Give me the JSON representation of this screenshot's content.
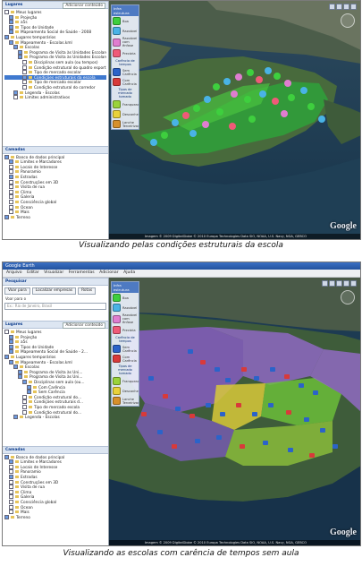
{
  "shot1": {
    "caption": "Visualizando pelas condições estruturais da escola",
    "left": {
      "lugares_header": "Lugares",
      "adicionar_conteudo": "Adicionar conteúdo",
      "lugares_items": [
        {
          "label": "Meus lugares",
          "indent": 0,
          "check": false,
          "selected": false
        },
        {
          "label": "Projeção",
          "indent": 1,
          "check": true,
          "selected": false
        },
        {
          "label": "a5s",
          "indent": 1,
          "check": true,
          "selected": false
        },
        {
          "label": "Tipos de Unidade",
          "indent": 1,
          "check": true,
          "selected": false
        },
        {
          "label": "Mapeamento Social de Saúde - 2008",
          "indent": 1,
          "check": true,
          "selected": false
        },
        {
          "label": "Lugares temporários",
          "indent": 0,
          "check": true,
          "selected": false
        },
        {
          "label": "Mapeamento - Escolas.kml",
          "indent": 1,
          "check": true,
          "selected": false
        },
        {
          "label": "Escolas",
          "indent": 2,
          "check": true,
          "selected": false
        },
        {
          "label": "Programa de Visita às Unidades Escolares / 2008",
          "indent": 3,
          "check": true,
          "selected": false
        },
        {
          "label": "Programa de Visita às Unidades Escolares / 2008",
          "indent": 3,
          "check": true,
          "selected": false
        },
        {
          "label": "Disciplinas sem aula (ou tempos)",
          "indent": 4,
          "check": false,
          "selected": false
        },
        {
          "label": "Condição estrutural do quadro esportivo",
          "indent": 4,
          "check": false,
          "selected": false
        },
        {
          "label": "Tipo de mercado escolar",
          "indent": 4,
          "check": false,
          "selected": false
        },
        {
          "label": "Condições estruturais da escola",
          "indent": 4,
          "check": true,
          "selected": true
        },
        {
          "label": "Tipo de mercado escolar",
          "indent": 4,
          "check": false,
          "selected": false
        },
        {
          "label": "Condição estrutural do corredor",
          "indent": 4,
          "check": false,
          "selected": false
        },
        {
          "label": "Legenda - Escolas",
          "indent": 2,
          "check": true,
          "selected": false
        },
        {
          "label": "Limites administrativos",
          "indent": 2,
          "check": false,
          "selected": false
        }
      ],
      "camadas_header": "Camadas",
      "camadas_items": [
        {
          "label": "Banco de dados principal",
          "indent": 0,
          "check": true
        },
        {
          "label": "Limites e Marcadores",
          "indent": 1,
          "check": true
        },
        {
          "label": "Locais de Interesse",
          "indent": 1,
          "check": false
        },
        {
          "label": "Panoramio",
          "indent": 1,
          "check": false
        },
        {
          "label": "Estradas",
          "indent": 1,
          "check": true
        },
        {
          "label": "Construções em 3D",
          "indent": 1,
          "check": false
        },
        {
          "label": "Visita de rua",
          "indent": 1,
          "check": false
        },
        {
          "label": "Clima",
          "indent": 1,
          "check": false
        },
        {
          "label": "Galeria",
          "indent": 1,
          "check": false
        },
        {
          "label": "Consciência global",
          "indent": 1,
          "check": false
        },
        {
          "label": "Ocean",
          "indent": 1,
          "check": false
        },
        {
          "label": "Mais",
          "indent": 1,
          "check": false
        },
        {
          "label": "Terreno",
          "indent": 0,
          "check": true
        }
      ]
    },
    "legend": {
      "header": "Infra estrutura",
      "items_a": [
        {
          "label": "Boa",
          "color": "#3ecf3e"
        },
        {
          "label": "Razoável",
          "color": "#49b3e6"
        },
        {
          "label": "Razoável com ênfase",
          "color": "#e07dd0"
        },
        {
          "label": "Precária",
          "color": "#f05a78"
        }
      ],
      "section_b": "Carência de tempos",
      "items_b": [
        {
          "label": "Sem Carência",
          "color": "#2b63c9"
        },
        {
          "label": "Com Carência",
          "color": "#d83a3a"
        }
      ],
      "section_c": "Tipos de mercado tomado",
      "items_c": [
        {
          "label": "Franqueado",
          "color": "#9ad33b"
        },
        {
          "label": "Desconhecido",
          "color": "#e8d13a"
        },
        {
          "label": "Lanche Terceirizado",
          "color": "#d6902c"
        }
      ]
    },
    "status": "Imagem © 2009 DigitalGlobe   © 2010 Europa Technologies   Data SIO, NOAA, U.S. Navy, NGA, GEBCO",
    "logo": "Google"
  },
  "shot2": {
    "caption": "Visualizando as escolas com carência de tempos sem aula",
    "window_title": "Google Earth",
    "menu": [
      "Arquivo",
      "Editar",
      "Visualizar",
      "Ferramentas",
      "Adicionar",
      "Ajuda"
    ],
    "left": {
      "pesquisar_header": "Pesquisar",
      "search_tabs": [
        "Voar para",
        "Localizar empresas",
        "Rotas"
      ],
      "search_label": "Voar para o",
      "search_placeholder": "Ex.: Rio de Janeiro, Brasil",
      "lugares_header": "Lugares",
      "adicionar_conteudo": "Adicionar conteúdo",
      "lugares_items": [
        {
          "label": "Meus lugares",
          "indent": 0,
          "check": false,
          "selected": false
        },
        {
          "label": "Projeção",
          "indent": 1,
          "check": true,
          "selected": false
        },
        {
          "label": "a5s",
          "indent": 1,
          "check": true,
          "selected": false
        },
        {
          "label": "Tipos de Unidade",
          "indent": 1,
          "check": true,
          "selected": false
        },
        {
          "label": "Mapeamento Social de Saúde - 2...",
          "indent": 1,
          "check": true,
          "selected": false
        },
        {
          "label": "Lugares temporários",
          "indent": 0,
          "check": true,
          "selected": false
        },
        {
          "label": "Mapeamento - Escolas.kml",
          "indent": 1,
          "check": true,
          "selected": false
        },
        {
          "label": "Escolas",
          "indent": 2,
          "check": true,
          "selected": false
        },
        {
          "label": "Programa de Visita às Uni...",
          "indent": 3,
          "check": true,
          "selected": false
        },
        {
          "label": "Programa de Visita às Uni...",
          "indent": 3,
          "check": true,
          "selected": false
        },
        {
          "label": "Disciplinas sem aula (ou...",
          "indent": 4,
          "check": true,
          "selected": false
        },
        {
          "label": "Com Carência",
          "indent": 5,
          "check": true,
          "selected": false
        },
        {
          "label": "Sem Carência",
          "indent": 5,
          "check": true,
          "selected": false
        },
        {
          "label": "Condição estrutural do...",
          "indent": 4,
          "check": false,
          "selected": false
        },
        {
          "label": "Condições estruturais d...",
          "indent": 4,
          "check": false,
          "selected": false
        },
        {
          "label": "Tipo de mercado escola",
          "indent": 4,
          "check": false,
          "selected": false
        },
        {
          "label": "Condição estrutural do...",
          "indent": 4,
          "check": false,
          "selected": false
        },
        {
          "label": "Legenda - Escolas",
          "indent": 2,
          "check": true,
          "selected": false
        }
      ],
      "camadas_header": "Camadas",
      "camadas_items": [
        {
          "label": "Banco de dados principal",
          "indent": 0,
          "check": true
        },
        {
          "label": "Limites e Marcadores",
          "indent": 1,
          "check": true
        },
        {
          "label": "Locais de Interesse",
          "indent": 1,
          "check": false
        },
        {
          "label": "Panoramio",
          "indent": 1,
          "check": false
        },
        {
          "label": "Estradas",
          "indent": 1,
          "check": true
        },
        {
          "label": "Construções em 3D",
          "indent": 1,
          "check": false
        },
        {
          "label": "Visita de rua",
          "indent": 1,
          "check": false
        },
        {
          "label": "Clima",
          "indent": 1,
          "check": false
        },
        {
          "label": "Galeria",
          "indent": 1,
          "check": false
        },
        {
          "label": "Consciência global",
          "indent": 1,
          "check": false
        },
        {
          "label": "Ocean",
          "indent": 1,
          "check": false
        },
        {
          "label": "Mais",
          "indent": 1,
          "check": false
        },
        {
          "label": "Terreno",
          "indent": 0,
          "check": true
        }
      ]
    },
    "legend": {
      "header": "Infra estrutura",
      "items_a": [
        {
          "label": "Boa",
          "color": "#3ecf3e"
        },
        {
          "label": "Razoável",
          "color": "#49b3e6"
        },
        {
          "label": "Razoável com ênfase",
          "color": "#e07dd0"
        },
        {
          "label": "Precária",
          "color": "#f05a78"
        }
      ],
      "section_b": "Carência de tempos",
      "items_b": [
        {
          "label": "Sem Carência",
          "color": "#2b63c9"
        },
        {
          "label": "Com Carência",
          "color": "#d83a3a"
        }
      ],
      "section_c": "Tipos de mercado tomado",
      "items_c": [
        {
          "label": "Franqueado",
          "color": "#9ad33b"
        },
        {
          "label": "Desconhecido",
          "color": "#e8d13a"
        },
        {
          "label": "Lanche Terceirizado",
          "color": "#d6902c"
        }
      ]
    },
    "status": "Imagem © 2009 DigitalGlobe   © 2010 Europa Technologies   Data SIO, NOAA, U.S. Navy, NGA, GEBCO",
    "logo": "Google"
  }
}
